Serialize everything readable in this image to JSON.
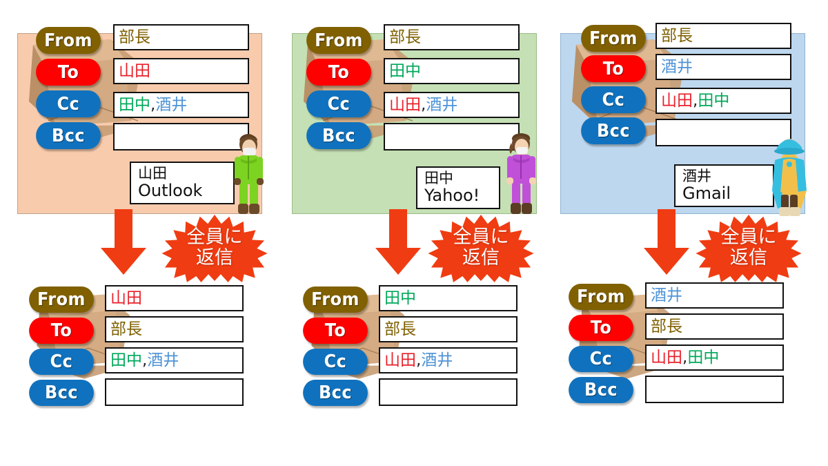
{
  "palette": {
    "panel_1_bg": "#F8CBAD",
    "panel_2_bg": "#C5E0B4",
    "panel_3_bg": "#BDD7EE",
    "pill_from": "#806000",
    "pill_to": "#FF0000",
    "pill_cc": "#1072BE",
    "pill_bcc": "#1072BE",
    "arrow": "#F03C12",
    "burst": "#F03C12",
    "name_boss": "#7F6000",
    "name_yamada": "#E8202A",
    "name_tanaka": "#00A85A",
    "name_sakai": "#4E93D6"
  },
  "labels": {
    "from": "From",
    "to": "To",
    "cc": "Cc",
    "bcc": "Bcc"
  },
  "names": {
    "boss": "部長",
    "yamada": "山田",
    "tanaka": "田中",
    "sakai": "酒井",
    "comma": ","
  },
  "action": {
    "line1": "全員に",
    "line2": "返信"
  },
  "columns": [
    {
      "id": "outlook",
      "bg": "#F8CBAD",
      "received": {
        "from": "部長",
        "to": "山田",
        "cc_first": "田中",
        "cc_second": "酒井",
        "bcc": ""
      },
      "client": {
        "user": "山田",
        "app": "Outlook"
      },
      "avatar": "green-tracksuit-avatar",
      "reply": {
        "from": "山田",
        "to": "部長",
        "cc_first": "田中",
        "cc_second": "酒井",
        "bcc": ""
      }
    },
    {
      "id": "yahoo",
      "bg": "#C5E0B4",
      "received": {
        "from": "部長",
        "to": "田中",
        "cc_first": "山田",
        "cc_second": "酒井",
        "bcc": ""
      },
      "client": {
        "user": "田中",
        "app": "Yahoo!"
      },
      "avatar": "purple-tracksuit-avatar",
      "reply": {
        "from": "田中",
        "to": "部長",
        "cc_first": "山田",
        "cc_second": "酒井",
        "bcc": ""
      }
    },
    {
      "id": "gmail",
      "bg": "#BDD7EE",
      "received": {
        "from": "部長",
        "to": "酒井",
        "cc_first": "山田",
        "cc_second": "田中",
        "bcc": ""
      },
      "client": {
        "user": "酒井",
        "app": "Gmail"
      },
      "avatar": "blue-cloak-avatar",
      "reply": {
        "from": "酒井",
        "to": "部長",
        "cc_first": "山田",
        "cc_second": "田中",
        "bcc": ""
      }
    }
  ]
}
